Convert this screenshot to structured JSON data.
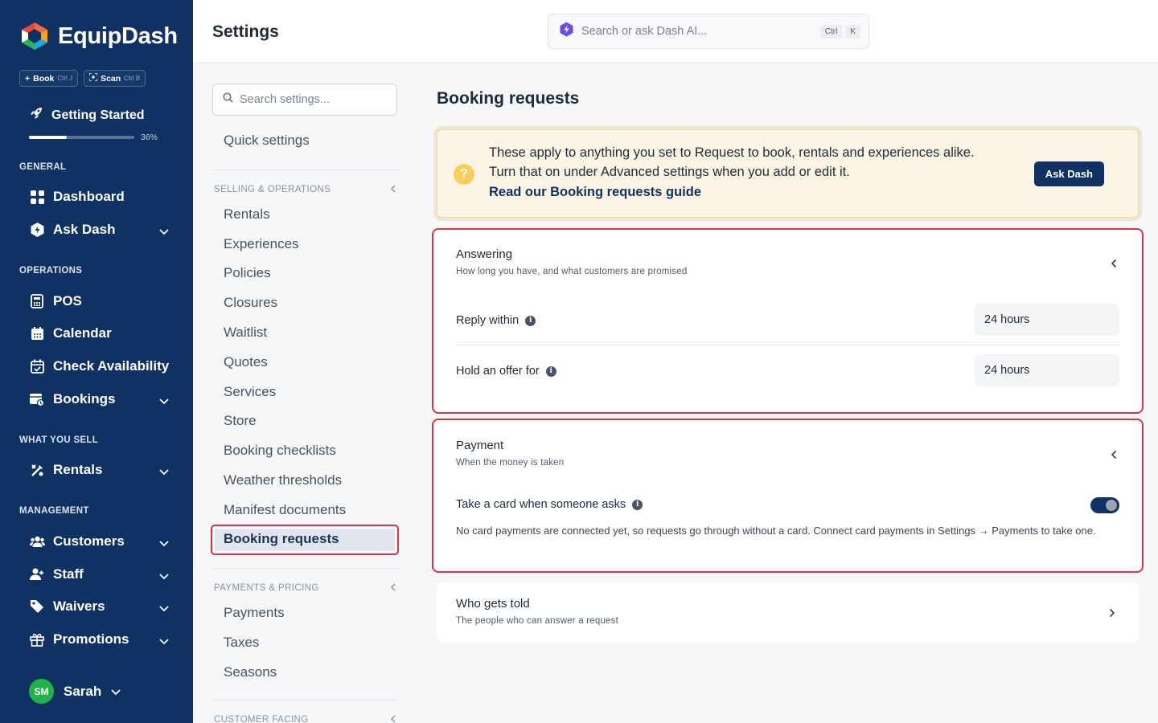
{
  "app": {
    "name": "EquipDash",
    "quick_actions": [
      {
        "label": "Book",
        "shortcut": "Ctrl J"
      },
      {
        "label": "Scan",
        "shortcut": "Ctrl B"
      }
    ],
    "getting_started": {
      "label": "Getting Started",
      "progress_text": "36%",
      "progress": 0.36
    }
  },
  "sidebar": {
    "sections": {
      "general": "GENERAL",
      "operations": "OPERATIONS",
      "what_you_sell": "WHAT YOU SELL",
      "management": "MANAGEMENT"
    },
    "items": {
      "dashboard": "Dashboard",
      "ask_dash": "Ask Dash",
      "pos": "POS",
      "calendar": "Calendar",
      "check_availability": "Check Availability",
      "bookings": "Bookings",
      "rentals": "Rentals",
      "customers": "Customers",
      "staff": "Staff",
      "waivers": "Waivers",
      "promotions": "Promotions"
    },
    "user": {
      "initials": "SM",
      "name": "Sarah"
    }
  },
  "header": {
    "title": "Settings",
    "search_placeholder": "Search or ask Dash AI...",
    "shortcut_keys": [
      "Ctrl",
      "K"
    ]
  },
  "settings_nav": {
    "search_placeholder": "Search settings...",
    "quick_settings": "Quick settings",
    "selling_section": "SELLING & OPERATIONS",
    "selling_items": [
      "Rentals",
      "Experiences",
      "Policies",
      "Closures",
      "Waitlist",
      "Quotes",
      "Services",
      "Store",
      "Booking checklists",
      "Weather thresholds",
      "Manifest documents"
    ],
    "active_item": "Booking requests",
    "payments_section": "PAYMENTS & PRICING",
    "payments_items": [
      "Payments",
      "Taxes",
      "Seasons"
    ],
    "customer_section": "CUSTOMER FACING"
  },
  "main": {
    "title": "Booking requests",
    "callout": {
      "line1": "These apply to anything you set to Request to book, rentals and experiences alike.",
      "line2": "Turn that on under Advanced settings when you add or edit it.",
      "link": "Read our Booking requests guide",
      "button": "Ask Dash"
    },
    "answering": {
      "title": "Answering",
      "subtitle": "How long you have, and what customers are promised",
      "reply_within_label": "Reply within",
      "reply_within_value": "24 hours",
      "hold_offer_label": "Hold an offer for",
      "hold_offer_value": "24 hours"
    },
    "payment": {
      "title": "Payment",
      "subtitle": "When the money is taken",
      "take_card_label": "Take a card when someone asks",
      "take_card_enabled": true,
      "note": "No card payments are connected yet, so requests go through without a card. Connect card payments in Settings → Payments to take one."
    },
    "who_gets_told": {
      "title": "Who gets told",
      "subtitle": "The people who can answer a request"
    }
  },
  "colors": {
    "sidebar_bg": "#0f3262",
    "accent": "#0f3262",
    "highlight_outline": "#d2384a",
    "callout_bg": "#fdf5e3",
    "avatar": "#22b24c"
  }
}
